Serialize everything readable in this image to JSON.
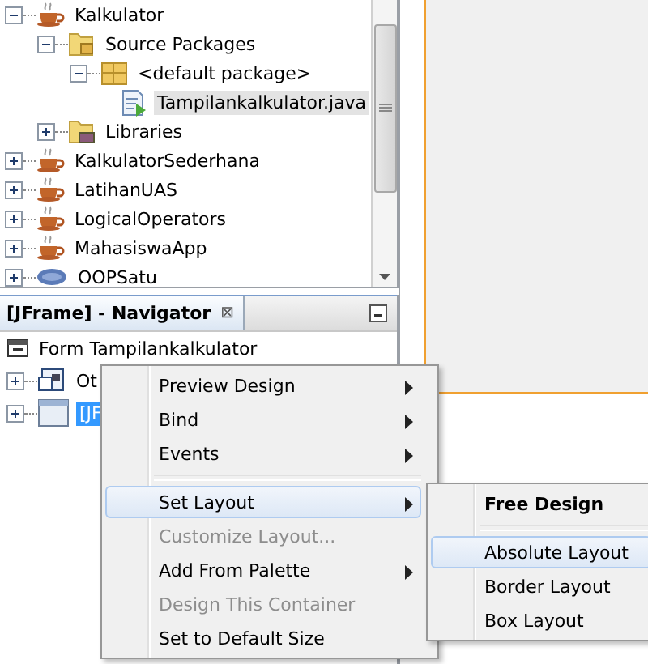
{
  "projects": {
    "items": [
      {
        "label": "Kalkulator",
        "kind": "project",
        "expanded": true,
        "selected": false,
        "children": [
          {
            "label": "Source Packages",
            "kind": "source-folder",
            "expanded": true,
            "selected": false,
            "children": [
              {
                "label": "<default package>",
                "kind": "package",
                "expanded": true,
                "selected": false,
                "children": [
                  {
                    "label": "Tampilankalkulator.java",
                    "kind": "java-file",
                    "selected": true
                  }
                ]
              }
            ]
          },
          {
            "label": "Libraries",
            "kind": "library",
            "expanded": false,
            "selected": false
          }
        ]
      },
      {
        "label": "KalkulatorSederhana",
        "kind": "project",
        "expanded": false,
        "selected": false
      },
      {
        "label": "LatihanUAS",
        "kind": "project",
        "expanded": false,
        "selected": false
      },
      {
        "label": "LogicalOperators",
        "kind": "project",
        "expanded": false,
        "selected": false
      },
      {
        "label": "MahasiswaApp",
        "kind": "project",
        "expanded": false,
        "selected": false
      },
      {
        "label": "OOPSatu",
        "kind": "php-project",
        "expanded": false,
        "selected": false
      }
    ]
  },
  "navigator": {
    "title": "[JFrame] - Navigator",
    "close": "⊠",
    "items": [
      {
        "label": "Form Tampilankalkulator",
        "kind": "form",
        "selected": false
      },
      {
        "label": "Ot",
        "kind": "other",
        "expanded": false,
        "selected": false
      },
      {
        "label": "[JF",
        "kind": "jframe",
        "expanded": false,
        "selected": true
      }
    ]
  },
  "context_menu": {
    "items": [
      {
        "label": "Preview Design",
        "kind": "submenu",
        "disabled": false,
        "selected": false
      },
      {
        "label": "Bind",
        "kind": "submenu",
        "disabled": false,
        "selected": false
      },
      {
        "label": "Events",
        "kind": "submenu",
        "disabled": false,
        "selected": false
      },
      {
        "kind": "separator"
      },
      {
        "label": "Set Layout",
        "kind": "submenu",
        "disabled": false,
        "selected": true
      },
      {
        "label": "Customize Layout...",
        "kind": "action",
        "disabled": true,
        "selected": false
      },
      {
        "label": "Add From Palette",
        "kind": "submenu",
        "disabled": false,
        "selected": false
      },
      {
        "label": "Design This Container",
        "kind": "action",
        "disabled": true,
        "selected": false
      },
      {
        "label": "Set to Default Size",
        "kind": "action",
        "disabled": false,
        "selected": false
      }
    ]
  },
  "layout_submenu": {
    "items": [
      {
        "label": "Free Design",
        "kind": "header",
        "selected": false
      },
      {
        "kind": "separator"
      },
      {
        "label": "Absolute Layout",
        "kind": "action",
        "selected": true
      },
      {
        "label": "Border Layout",
        "kind": "action",
        "selected": false
      },
      {
        "label": "Box Layout",
        "kind": "action",
        "selected": false
      }
    ]
  }
}
